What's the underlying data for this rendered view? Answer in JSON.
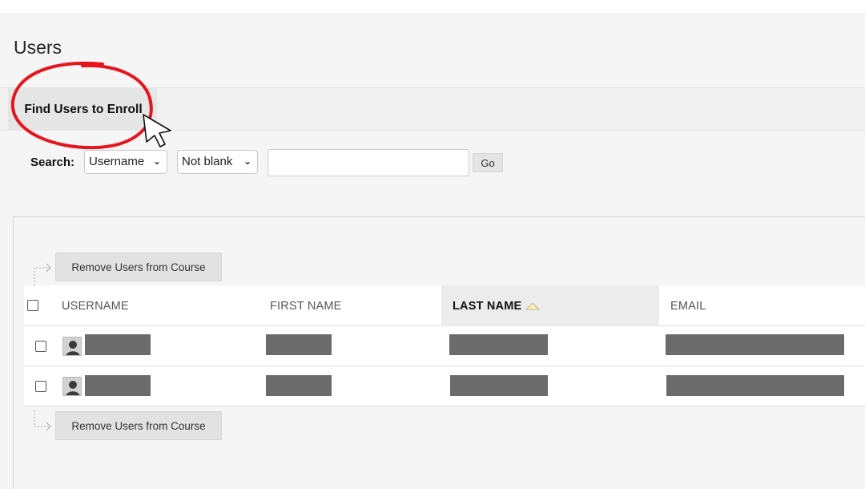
{
  "page": {
    "title": "Users"
  },
  "action_bar": {
    "find_users_label": "Find Users to Enroll"
  },
  "search": {
    "label": "Search:",
    "field_select": "Username",
    "operator_select": "Not blank",
    "query_value": "",
    "go_label": "Go"
  },
  "table": {
    "remove_button_label": "Remove Users from Course",
    "columns": [
      "USERNAME",
      "FIRST NAME",
      "LAST NAME",
      "EMAIL"
    ],
    "sorted_column": "LAST NAME",
    "sort_direction": "ascending",
    "rows": [
      {
        "username": "[redacted]",
        "first_name": "[redacted]",
        "last_name": "[redacted]",
        "email": "[redacted]"
      },
      {
        "username": "[redacted]",
        "first_name": "[redacted]",
        "last_name": "[redacted]",
        "email": "[redacted]"
      }
    ]
  },
  "colors": {
    "annotation": "#e8141c",
    "redaction": "#6b6b6b"
  },
  "icons": {
    "sort": "triangle-up-icon",
    "avatar": "user-silhouette-icon",
    "cursor": "mouse-pointer-icon"
  }
}
